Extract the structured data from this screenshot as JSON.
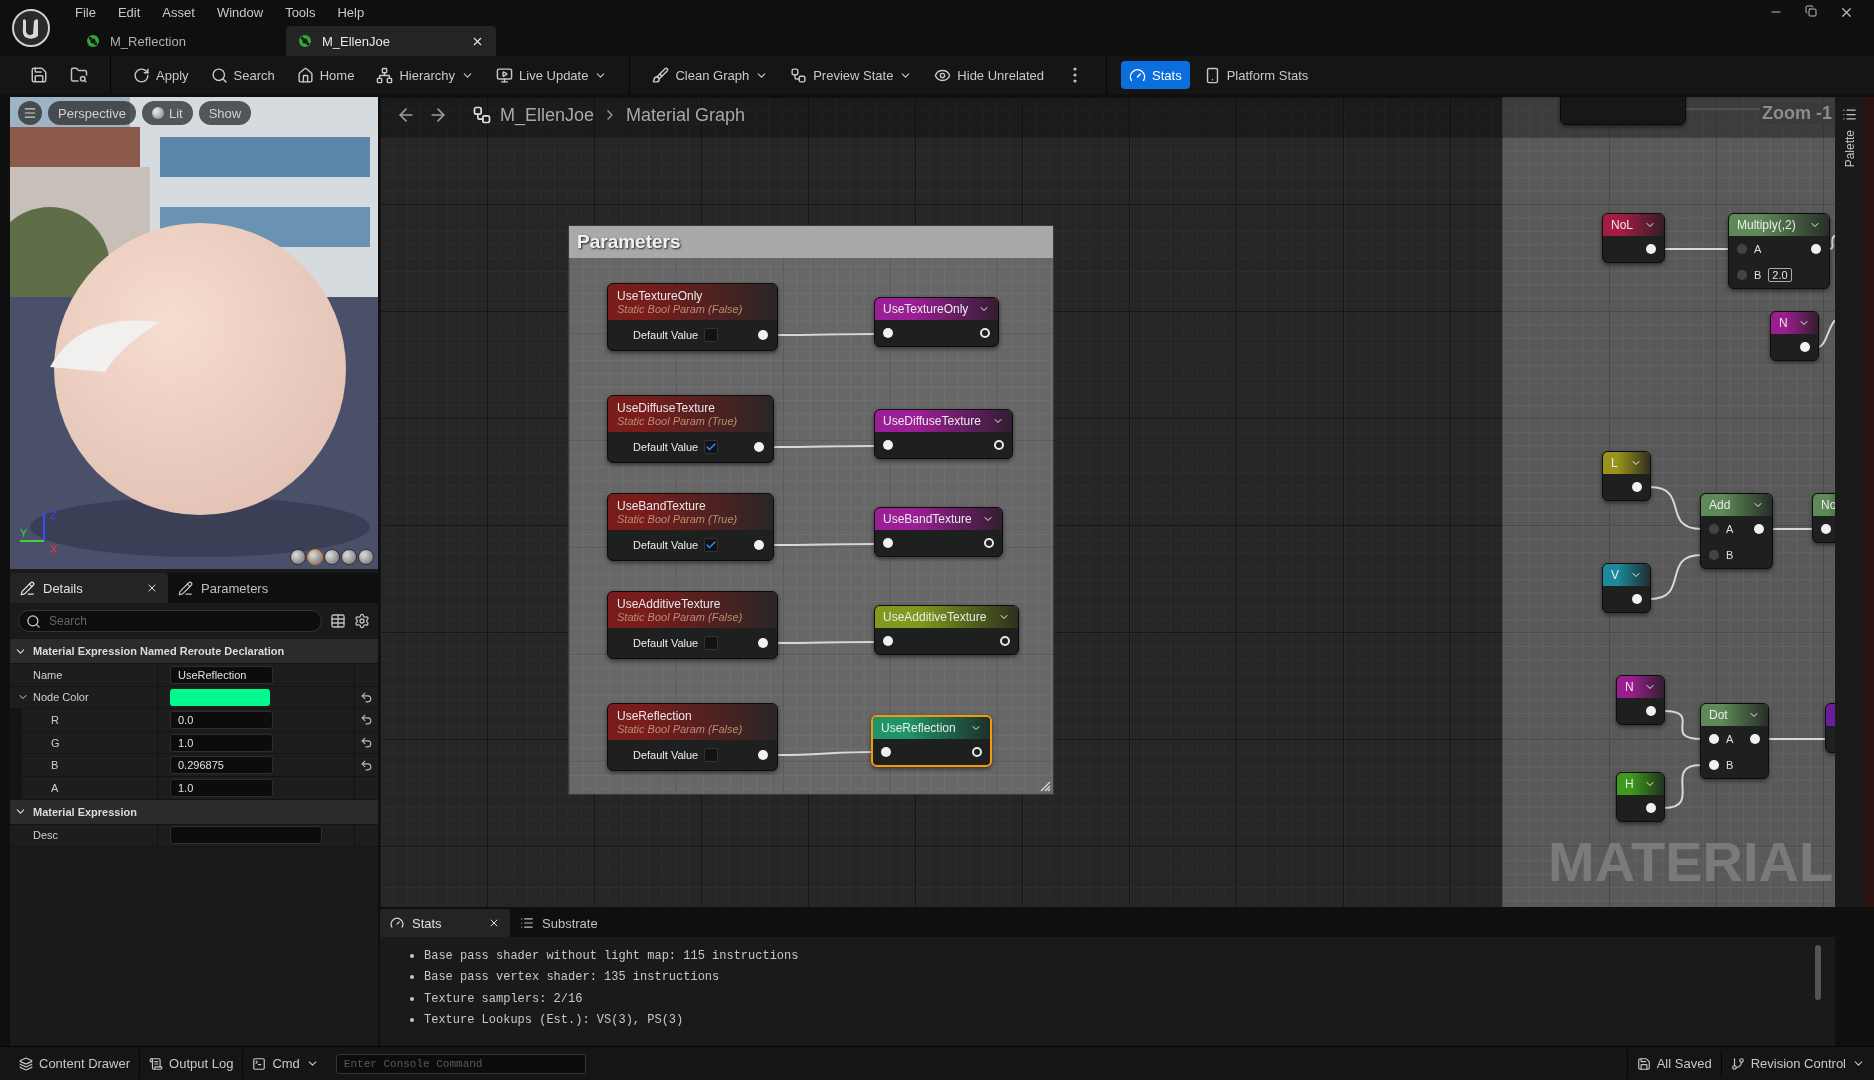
{
  "menu": [
    "File",
    "Edit",
    "Asset",
    "Window",
    "Tools",
    "Help"
  ],
  "document_tabs": [
    {
      "label": "M_Reflection",
      "selected": false
    },
    {
      "label": "M_EllenJoe",
      "selected": true
    }
  ],
  "toolbar": {
    "groups": [
      {
        "items": [
          {
            "label": "Apply",
            "dropdown": false,
            "selected": false
          },
          {
            "label": "Search",
            "dropdown": false,
            "selected": false
          },
          {
            "label": "Home",
            "dropdown": false,
            "selected": false
          },
          {
            "label": "Hierarchy",
            "dropdown": true,
            "selected": false
          },
          {
            "label": "Live Update",
            "dropdown": true,
            "selected": false
          }
        ]
      },
      {
        "items": [
          {
            "label": "Clean Graph",
            "dropdown": true,
            "selected": false
          },
          {
            "label": "Preview State",
            "dropdown": true,
            "selected": false
          },
          {
            "label": "Hide Unrelated",
            "dropdown": false,
            "selected": false
          }
        ]
      },
      {
        "items": [
          {
            "label": "Stats",
            "dropdown": false,
            "selected": true
          },
          {
            "label": "Platform Stats",
            "dropdown": false,
            "selected": false
          }
        ]
      }
    ]
  },
  "viewport": {
    "buttons": [
      "Perspective",
      "Lit",
      "Show"
    ],
    "axes": [
      "Z",
      "Y",
      "X"
    ]
  },
  "details": {
    "tabs": [
      {
        "label": "Details",
        "selected": true
      },
      {
        "label": "Parameters",
        "selected": false
      }
    ],
    "search_placeholder": "Search",
    "sections": [
      {
        "title": "Material Expression Named Reroute Declaration",
        "expanded": true,
        "rows": [
          {
            "kind": "text",
            "label": "Name",
            "value": "UseReflection",
            "reset": false
          },
          {
            "kind": "color",
            "label": "Node Color",
            "color": "#00fa8e",
            "reset": true,
            "expanded": true,
            "children": [
              {
                "kind": "text",
                "label": "R",
                "value": "0.0",
                "reset": true
              },
              {
                "kind": "text",
                "label": "G",
                "value": "1.0",
                "reset": true
              },
              {
                "kind": "text",
                "label": "B",
                "value": "0.296875",
                "reset": true
              },
              {
                "kind": "text",
                "label": "A",
                "value": "1.0",
                "reset": false
              }
            ]
          }
        ]
      },
      {
        "title": "Material Expression",
        "expanded": true,
        "rows": [
          {
            "kind": "wide_text",
            "label": "Desc",
            "reset": false
          }
        ]
      }
    ]
  },
  "graph": {
    "breadcrumb": {
      "asset": "M_EllenJoe",
      "graph": "Material Graph"
    },
    "zoom_label": "Zoom -1",
    "corner_label": "MATERIAL",
    "palette_label": "Palette",
    "comment": {
      "title": "Parameters"
    },
    "param_nodes": [
      {
        "title": "UseTextureOnly",
        "subtitle": "Static Bool Param (False)",
        "field_label": "Default Value",
        "checked": false
      },
      {
        "title": "UseDiffuseTexture",
        "subtitle": "Static Bool Param (True)",
        "field_label": "Default Value",
        "checked": true
      },
      {
        "title": "UseBandTexture",
        "subtitle": "Static Bool Param (True)",
        "field_label": "Default Value",
        "checked": true
      },
      {
        "title": "UseAdditiveTexture",
        "subtitle": "Static Bool Param (False)",
        "field_label": "Default Value",
        "checked": false
      },
      {
        "title": "UseReflection",
        "subtitle": "Static Bool Param (False)",
        "field_label": "Default Value",
        "checked": false
      }
    ],
    "reroute_nodes": [
      {
        "title": "UseTextureOnly",
        "color": "#9c1e96",
        "selected": false
      },
      {
        "title": "UseDiffuseTexture",
        "color": "#9c1e96",
        "selected": false
      },
      {
        "title": "UseBandTexture",
        "color": "#9c1e96",
        "selected": false
      },
      {
        "title": "UseAdditiveTexture",
        "color": "#7f9a1c",
        "selected": false
      },
      {
        "title": "UseReflection",
        "color": "#1e9468",
        "selected": true
      }
    ],
    "nodes": [
      {
        "kind": "var",
        "title": "NoL",
        "color": "#a41c44"
      },
      {
        "kind": "op",
        "title": "Multiply(,2)",
        "pins": [
          {
            "label": "A"
          },
          {
            "label": "B",
            "value": "2.0"
          }
        ]
      },
      {
        "kind": "var",
        "title": "N",
        "color": "#9c1e8e"
      },
      {
        "kind": "var",
        "title": "L",
        "color": "#9a941c"
      },
      {
        "kind": "op",
        "title": "Add",
        "pins": [
          {
            "label": "A"
          },
          {
            "label": "B"
          }
        ]
      },
      {
        "kind": "op",
        "title": "No"
      },
      {
        "kind": "var",
        "title": "V",
        "color": "#1c8a9a"
      },
      {
        "kind": "var",
        "title": "N",
        "color": "#9c1e8e"
      },
      {
        "kind": "op",
        "title": "Dot",
        "pins": [
          {
            "label": "A"
          },
          {
            "label": "B"
          }
        ]
      },
      {
        "kind": "var",
        "color": "#6a1e9c"
      },
      {
        "kind": "var",
        "title": "H",
        "color": "#3c9a1c"
      }
    ]
  },
  "stats": {
    "tabs": [
      {
        "label": "Stats",
        "selected": true
      },
      {
        "label": "Substrate",
        "selected": false
      }
    ],
    "lines": [
      "Base pass shader without light map: 115 instructions",
      "Base pass vertex shader: 135 instructions",
      "Texture samplers: 2/16",
      "Texture Lookups (Est.): VS(3), PS(3)"
    ]
  },
  "status_bar": {
    "left": [
      "Content Drawer",
      "Output Log"
    ],
    "cmd": {
      "label": "Cmd",
      "placeholder": "Enter Console Command"
    },
    "right": [
      "All Saved",
      "Revision Control"
    ]
  }
}
